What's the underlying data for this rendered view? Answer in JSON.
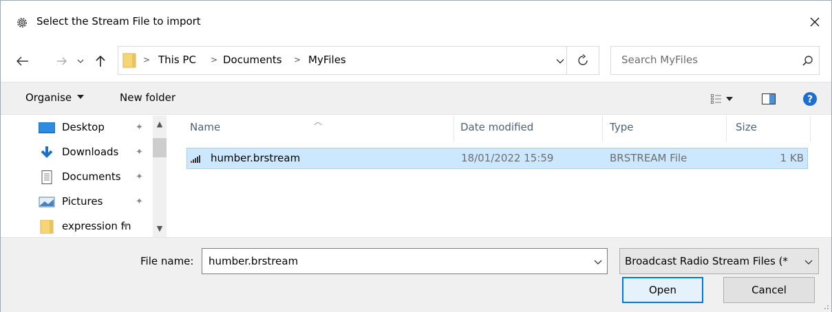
{
  "window": {
    "title": "Select the Stream File to import",
    "close_label": "✕"
  },
  "address": {
    "crumbs": [
      "This PC",
      "Documents",
      "MyFiles"
    ],
    "search_placeholder": "Search MyFiles"
  },
  "toolbar": {
    "organise_label": "Organise",
    "new_folder_label": "New folder"
  },
  "nav": {
    "items": [
      {
        "label": "Desktop",
        "icon": "desktop-icon"
      },
      {
        "label": "Downloads",
        "icon": "downloads-icon"
      },
      {
        "label": "Documents",
        "icon": "documents-icon"
      },
      {
        "label": "Pictures",
        "icon": "pictures-icon"
      },
      {
        "label": "expression fn",
        "icon": "folder-icon"
      }
    ]
  },
  "filelist": {
    "columns": [
      "Name",
      "Date modified",
      "Type",
      "Size"
    ],
    "rows": [
      {
        "name": "humber.brstream",
        "date": "18/01/2022 15:59",
        "type": "BRSTREAM File",
        "size": "1 KB",
        "selected": true
      }
    ]
  },
  "bottom": {
    "file_name_label": "File name:",
    "file_name_value": "humber.brstream",
    "file_type_value": "Broadcast Radio Stream Files (*",
    "open_label": "Open",
    "cancel_label": "Cancel"
  },
  "colors": {
    "accent": "#0078d7",
    "selection": "#cce8ff",
    "help": "#1c6fcf"
  }
}
